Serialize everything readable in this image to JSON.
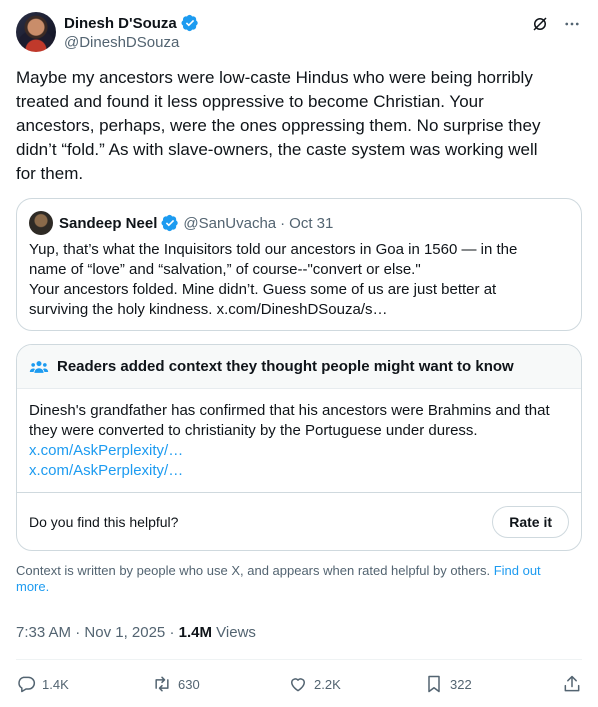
{
  "author": {
    "display_name": "Dinesh D'Souza",
    "handle": "@DineshDSouza",
    "verified": true
  },
  "tweet": {
    "text": "Maybe my ancestors were low-caste Hindus who were being horribly\ntreated and found it less oppressive to become Christian. Your\nancestors, perhaps, were the ones oppressing them. No surprise they\ndidn’t “fold.” As with slave-owners, the caste system was working well\nfor them."
  },
  "quote": {
    "display_name": "Sandeep Neel",
    "handle": "@SanUvacha",
    "separator": "·",
    "date": "Oct 31",
    "text": "Yup, that’s what the Inquisitors told our ancestors in Goa in 1560 — in the\nname of “love” and “salvation,” of course--\"convert or else.\"\nYour ancestors folded. Mine didn’t. Guess some of us are just better at\nsurviving the holy kindness. x.com/DineshDSouza/s…"
  },
  "community_note": {
    "header": "Readers added context they thought people might want to know",
    "body": "Dinesh's grandfather has confirmed that his ancestors were Brahmins and that they were converted to christianity by the Portuguese under duress.",
    "links": [
      "x.com/AskPerplexity/…",
      "x.com/AskPerplexity/…"
    ],
    "helpful_prompt": "Do you find this helpful?",
    "rate_button": "Rate it",
    "footer_text": "Context is written by people who use X, and appears when rated helpful by others.",
    "footer_link": "Find out more."
  },
  "meta": {
    "time": "7:33 AM",
    "separator": "·",
    "date": "Nov 1, 2025",
    "views_count": "1.4M",
    "views_label": "Views"
  },
  "actions": {
    "replies": "1.4K",
    "reposts": "630",
    "likes": "2.2K",
    "bookmarks": "322"
  },
  "colors": {
    "accent": "#1d9bf0",
    "secondary_text": "#536471",
    "border": "#cfd9de"
  }
}
